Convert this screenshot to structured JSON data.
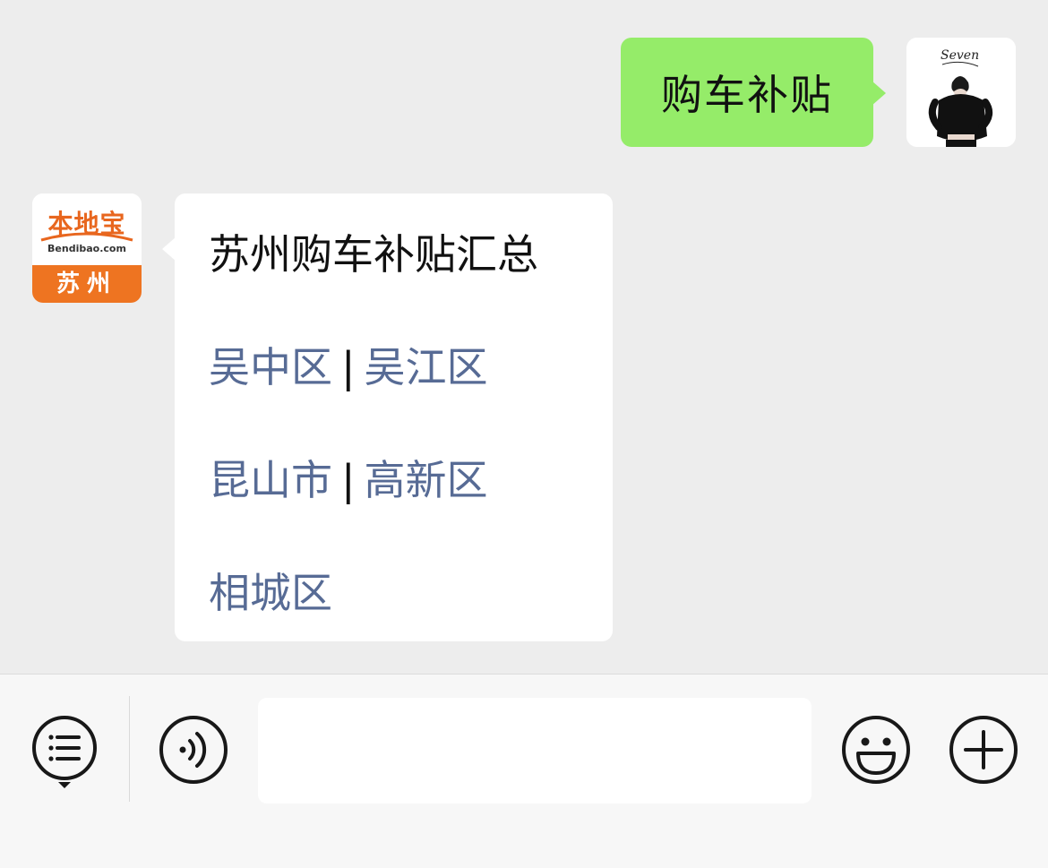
{
  "chat": {
    "messages": [
      {
        "sender": "user",
        "text": "购车补贴",
        "avatar_text": "Seven"
      },
      {
        "sender": "bot",
        "avatar": {
          "logo_text": "本地宝",
          "logo_subtext": "Bendibao.com",
          "city": "苏州"
        },
        "title": "苏州购车补贴汇总",
        "links": [
          [
            "吴中区",
            "吴江区"
          ],
          [
            "昆山市",
            "高新区"
          ],
          [
            "相城区"
          ]
        ],
        "separator": "|"
      }
    ]
  },
  "input_bar": {
    "icons": [
      "menu-list-icon",
      "voice-icon",
      "emoji-icon",
      "plus-icon"
    ],
    "input_value": ""
  },
  "colors": {
    "background": "#ededed",
    "user_bubble": "#95ec69",
    "bot_bubble": "#ffffff",
    "link": "#576b95",
    "logo_orange": "#ee7421"
  }
}
